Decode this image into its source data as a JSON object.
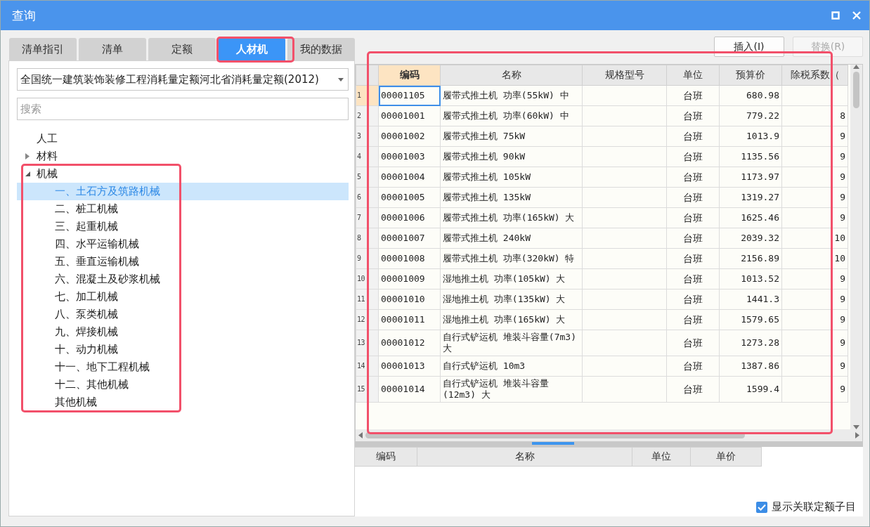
{
  "window": {
    "title": "查询"
  },
  "tabs": [
    {
      "label": "清单指引",
      "selected": false
    },
    {
      "label": "清单",
      "selected": false
    },
    {
      "label": "定额",
      "selected": false
    },
    {
      "label": "人材机",
      "selected": true
    },
    {
      "label": "我的数据",
      "selected": false
    }
  ],
  "library_select": {
    "value": "全国统一建筑装饰装修工程消耗量定额河北省消耗量定额(2012)"
  },
  "search": {
    "placeholder": "搜索"
  },
  "tree": [
    {
      "label": "人工",
      "selected": false
    },
    {
      "label": "材料",
      "expanded": false,
      "selected": false
    },
    {
      "label": "机械",
      "expanded": true,
      "selected": false,
      "children": [
        {
          "label": "一、土石方及筑路机械",
          "selected": true
        },
        {
          "label": "二、桩工机械",
          "selected": false
        },
        {
          "label": "三、起重机械",
          "selected": false
        },
        {
          "label": "四、水平运输机械",
          "selected": false
        },
        {
          "label": "五、垂直运输机械",
          "selected": false
        },
        {
          "label": "六、混凝土及砂浆机械",
          "selected": false
        },
        {
          "label": "七、加工机械",
          "selected": false
        },
        {
          "label": "八、泵类机械",
          "selected": false
        },
        {
          "label": "九、焊接机械",
          "selected": false
        },
        {
          "label": "十、动力机械",
          "selected": false
        },
        {
          "label": "十一、地下工程机械",
          "selected": false
        },
        {
          "label": "十二、其他机械",
          "selected": false
        },
        {
          "label": "其他机械",
          "selected": false
        }
      ]
    }
  ],
  "buttons": [
    {
      "label": "插入(I)",
      "disabled": false
    },
    {
      "label": "替换(R)",
      "disabled": true
    }
  ],
  "table": {
    "columns": [
      {
        "label": "编码",
        "selected": true
      },
      {
        "label": "名称",
        "selected": false
      },
      {
        "label": "规格型号",
        "selected": false
      },
      {
        "label": "单位",
        "selected": false
      },
      {
        "label": "预算价",
        "selected": false
      },
      {
        "label": "除税系数（",
        "selected": false
      }
    ],
    "rows": [
      {
        "number": "1",
        "selected": true,
        "code": "00001105",
        "name": "履带式推土机 功率(55kW) 中",
        "unit": "台班",
        "price": "680.98"
      },
      {
        "number": "2",
        "selected": false,
        "code": "00001001",
        "name": "履带式推土机 功率(60kW) 中",
        "unit": "台班",
        "price": "779.22",
        "factor": "8"
      },
      {
        "number": "3",
        "selected": false,
        "code": "00001002",
        "name": "履带式推土机 75kW",
        "unit": "台班",
        "price": "1013.9",
        "factor": "9"
      },
      {
        "number": "4",
        "selected": false,
        "code": "00001003",
        "name": "履带式推土机 90kW",
        "unit": "台班",
        "price": "1135.56",
        "factor": "9"
      },
      {
        "number": "5",
        "selected": false,
        "code": "00001004",
        "name": "履带式推土机 105kW",
        "unit": "台班",
        "price": "1173.97",
        "factor": "9"
      },
      {
        "number": "6",
        "selected": false,
        "code": "00001005",
        "name": "履带式推土机 135kW",
        "unit": "台班",
        "price": "1319.27",
        "factor": "9"
      },
      {
        "number": "7",
        "selected": false,
        "code": "00001006",
        "name": "履带式推土机 功率(165kW) 大",
        "unit": "台班",
        "price": "1625.46",
        "factor": "9"
      },
      {
        "number": "8",
        "selected": false,
        "code": "00001007",
        "name": "履带式推土机 240kW",
        "unit": "台班",
        "price": "2039.32",
        "factor": "10"
      },
      {
        "number": "9",
        "selected": false,
        "code": "00001008",
        "name": "履带式推土机 功率(320kW) 特",
        "unit": "台班",
        "price": "2156.89",
        "factor": "10"
      },
      {
        "number": "10",
        "selected": false,
        "code": "00001009",
        "name": "湿地推土机 功率(105kW) 大",
        "unit": "台班",
        "price": "1013.52",
        "factor": "9"
      },
      {
        "number": "11",
        "selected": false,
        "code": "00001010",
        "name": "湿地推土机 功率(135kW) 大",
        "unit": "台班",
        "price": "1441.3",
        "factor": "9"
      },
      {
        "number": "12",
        "selected": false,
        "code": "00001011",
        "name": "湿地推土机 功率(165kW) 大",
        "unit": "台班",
        "price": "1579.65",
        "factor": "9"
      },
      {
        "number": "13",
        "selected": false,
        "code": "00001012",
        "name": "自行式铲运机 堆装斗容量(7m3) 大",
        "unit": "台班",
        "price": "1273.28",
        "factor": "9"
      },
      {
        "number": "14",
        "selected": false,
        "code": "00001013",
        "name": "自行式铲运机 10m3",
        "unit": "台班",
        "price": "1387.86",
        "factor": "9"
      },
      {
        "number": "15",
        "selected": false,
        "code": "00001014",
        "name": "自行式铲运机 堆装斗容量(12m3) 大",
        "unit": "台班",
        "price": "1599.4",
        "factor": "9"
      }
    ]
  },
  "detail_table": {
    "columns": [
      "编码",
      "名称",
      "单位",
      "单价"
    ]
  },
  "show_linked": {
    "label": "显示关联定额子目",
    "checked": true
  }
}
